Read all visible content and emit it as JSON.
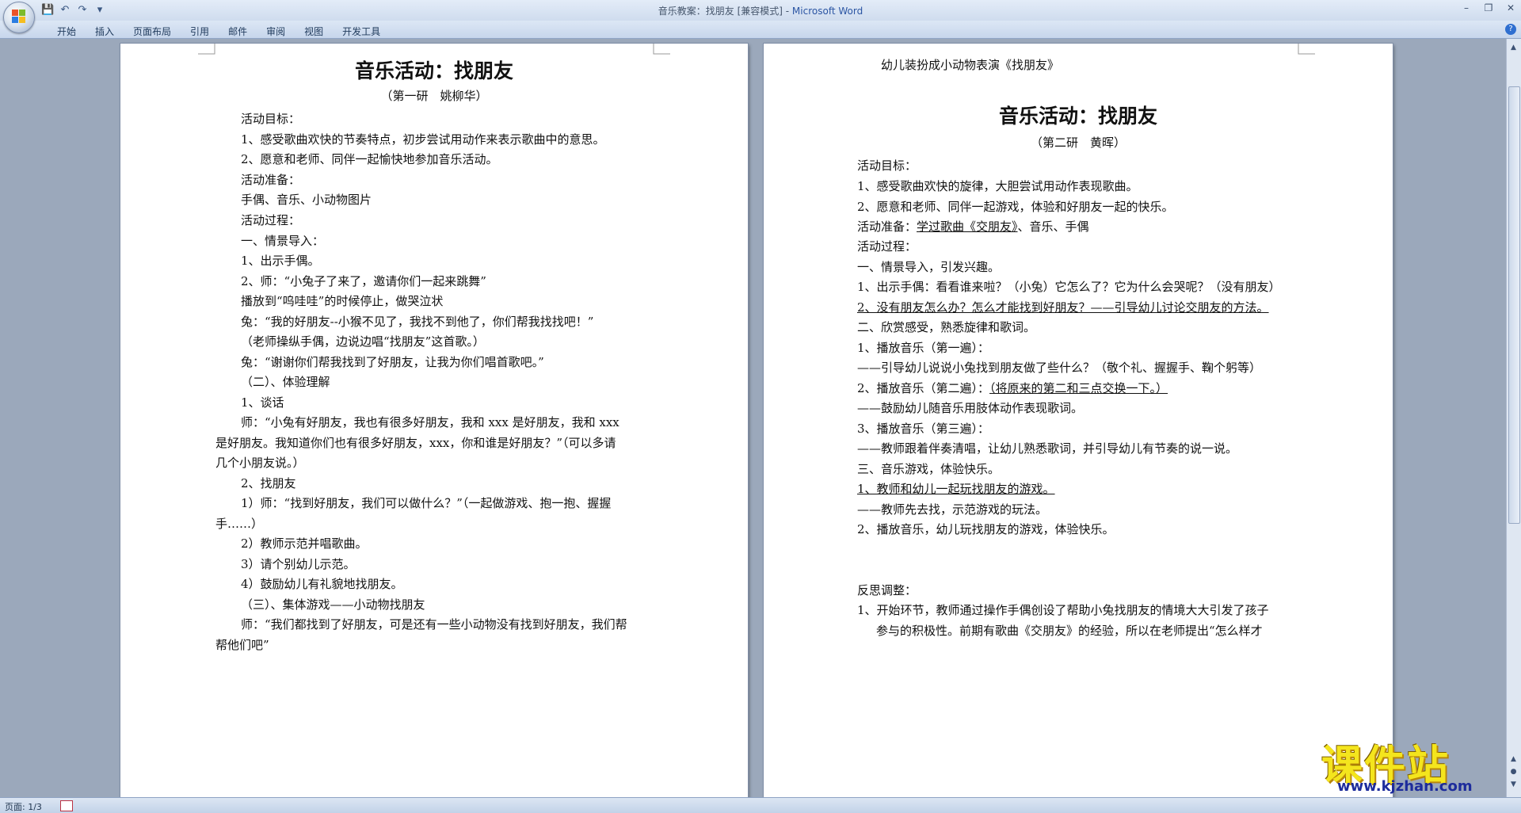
{
  "window": {
    "doc_title": "音乐教案：找朋友 [兼容模式] - ",
    "app_name": "Microsoft Word"
  },
  "ribbon": {
    "tabs": [
      "开始",
      "插入",
      "页面布局",
      "引用",
      "邮件",
      "审阅",
      "视图",
      "开发工具"
    ],
    "help": "?"
  },
  "left_page": {
    "title": "音乐活动：找朋友",
    "subtitle": "（第一研　姚柳华）",
    "lines": [
      "活动目标：",
      "1、感受歌曲欢快的节奏特点，初步尝试用动作来表示歌曲中的意思。",
      "2、愿意和老师、同伴一起愉快地参加音乐活动。",
      "活动准备：",
      "手偶、音乐、小动物图片",
      "活动过程：",
      "一、情景导入：",
      "1、出示手偶。",
      "2、师：“小兔子了来了，邀请你们一起来跳舞”",
      "播放到“呜哇哇”的时候停止，做哭泣状",
      "兔：“我的好朋友--小猴不见了，我找不到他了，你们帮我找找吧！”",
      "（老师操纵手偶，边说边唱“找朋友”这首歌。）",
      "兔：“谢谢你们帮我找到了好朋友，让我为你们唱首歌吧。”",
      "（二）、体验理解",
      "1、谈话",
      "师：“小兔有好朋友，我也有很多好朋友，我和 xxx 是好朋友，我和 xxx",
      "是好朋友。我知道你们也有很多好朋友，xxx，你和谁是好朋友？”（可以多请",
      "几个小朋友说。）",
      "2、找朋友",
      "1）师：“找到好朋友，我们可以做什么？”（一起做游戏、抱一抱、握握",
      "手……）",
      "2）教师示范并唱歌曲。",
      "3）请个别幼儿示范。",
      "4）鼓励幼儿有礼貌地找朋友。",
      "（三）、集体游戏——小动物找朋友",
      "师：“我们都找到了好朋友，可是还有一些小动物没有找到好朋友，我们帮",
      "帮他们吧”"
    ]
  },
  "right_page": {
    "top_line": "幼儿装扮成小动物表演《找朋友》",
    "title": "音乐活动：找朋友",
    "subtitle": "（第二研　黄晖）",
    "lines": [
      "活动目标：",
      "1、感受歌曲欢快的旋律，大胆尝试用动作表现歌曲。",
      "2、愿意和老师、同伴一起游戏，体验和好朋友一起的快乐。",
      "活动准备：",
      "学过歌曲《交朋友》",
      "、音乐、手偶",
      "活动过程：",
      "一、情景导入，引发兴趣。",
      "1、出示手偶：看看谁来啦？（小兔）它怎么了？它为什么会哭呢？（没有朋友）",
      "2、没有朋友怎么办？怎么才能找到好朋友？——引导幼儿讨论交朋友的方法。",
      "二、欣赏感受，熟悉旋律和歌词。",
      "1、播放音乐（第一遍）：",
      "——引导幼儿说说小兔找到朋友做了些什么？（敬个礼、握握手、鞠个躬等）",
      "2、播放音乐（第二遍）：",
      "（将原来的第二和三点交换一下。）",
      "——鼓励幼儿随音乐用肢体动作表现歌词。",
      "3、播放音乐（第三遍）：",
      "——教师跟着伴奏清唱，让幼儿熟悉歌词，并引导幼儿有节奏的说一说。",
      "三、音乐游戏，体验快乐。",
      "1、教师和幼儿一起玩找朋友的游戏。",
      "——教师先去找，示范游戏的玩法。",
      "2、播放音乐，幼儿玩找朋友的游戏，体验快乐。",
      "反思调整：",
      "1、开始环节，教师通过操作手偶创设了帮助小兔找朋友的情境大大引发了孩子",
      "参与的积极性。前期有歌曲《交朋友》的经验，所以在老师提出“怎么样才"
    ]
  },
  "status": {
    "page": "页面: 1/3"
  },
  "watermark": {
    "text": "课件站",
    "url": "www.kjzhan.com"
  }
}
